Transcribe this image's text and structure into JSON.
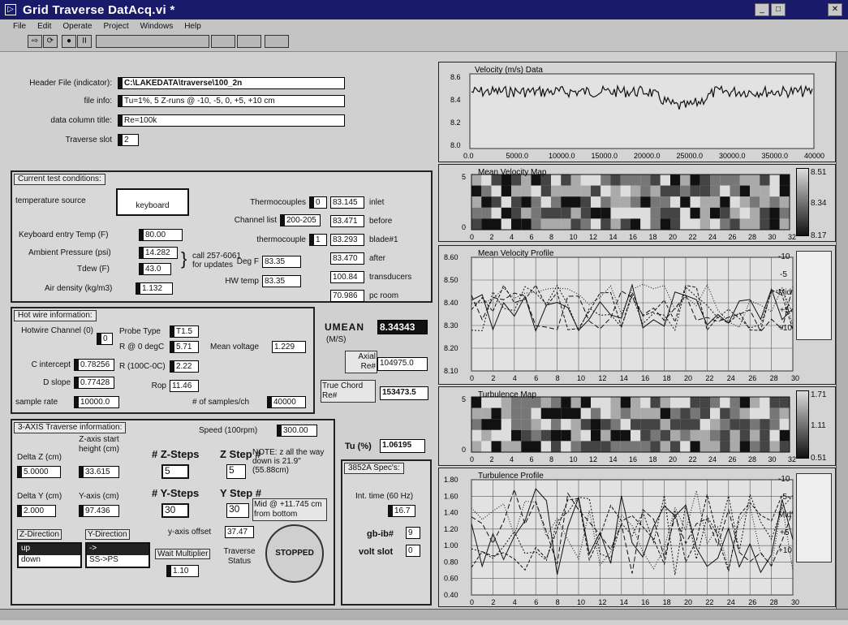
{
  "window": {
    "title": "Grid Traverse DatAcq.vi *"
  },
  "menu": [
    "File",
    "Edit",
    "Operate",
    "Project",
    "Windows",
    "Help"
  ],
  "header": {
    "file_label": "Header File (indicator):",
    "file_value": "C:\\LAKEDATA\\traverse\\100_2n",
    "info_label": "file info:",
    "info_value": "Tu=1%, 5 Z-runs @ -10, -5, 0, +5, +10 cm",
    "col_label": "data column title:",
    "col_value": "Re=100k",
    "slot_label": "Traverse slot",
    "slot_value": "2"
  },
  "conditions": {
    "title": "Current test conditions:",
    "temp_source_label": "temperature source",
    "temp_source_value": "keyboard",
    "keyboard_temp_label": "Keyboard entry Temp (F)",
    "keyboard_temp_value": "80.00",
    "ambient_label": "Ambient Pressure (psi)",
    "ambient_value": "14.282",
    "tdew_label": "Tdew (F)",
    "tdew_value": "43.0",
    "call_note": "call 257-6061 for updates",
    "air_label": "Air density (kg/m3)",
    "air_value": "1.132",
    "thermo_label": "Thermocouples",
    "thermo_value": "0",
    "channel_label": "Channel list",
    "channel_value": "200-205",
    "tc_label": "thermocouple",
    "tc_value": "1",
    "degf_label": "Deg F",
    "degf_value": "83.35",
    "hw_label": "HW temp",
    "hw_value": "83.35",
    "readings": [
      "83.145",
      "83.471",
      "83.293",
      "83.470",
      "100.84",
      "70.986"
    ],
    "locations": [
      "inlet",
      "before",
      "blade#1",
      "after",
      "transducers",
      "pc room"
    ]
  },
  "hotwire": {
    "title": "Hot wire information:",
    "channel_label": "Hotwire Channel (0)",
    "channel_value": "0",
    "probe_label": "Probe Type",
    "probe_value": "T1.5",
    "r0_label": "R @ 0 degC",
    "r0_value": "5.71",
    "mv_label": "Mean voltage",
    "mv_value": "1.229",
    "ci_label": "C intercept",
    "ci_value": "0.78256",
    "ds_label": "D slope",
    "ds_value": "0.77428",
    "r100_label": "R (100C-0C)",
    "r100_value": "2.22",
    "rop_label": "Rop",
    "rop_value": "11.46",
    "sr_label": "sample rate",
    "sr_value": "10000.0",
    "ns_label": "# of samples/ch",
    "ns_value": "40000"
  },
  "umean": {
    "label": "UMEAN",
    "unit": "(M/S)",
    "value": "8.34343"
  },
  "axial": {
    "label": "Axial Re#",
    "value": "104975.0"
  },
  "chord": {
    "label": "True Chord Re#",
    "value": "153473.5"
  },
  "traverse": {
    "title": "3-AXIS Traverse information:",
    "speed_label": "Speed (100rpm)",
    "speed_value": "300.00",
    "dz_label": "Delta Z (cm)",
    "dz_value": "5.0000",
    "zstart_label": "Z-axis start height (cm)",
    "zstart_value": "33.615",
    "zsteps_label": "# Z-Steps",
    "zsteps_value": "5",
    "zstep_label": "Z Step #",
    "zstep_value": "5",
    "note": "NOTE: z all the way down is 21.9\" (55.88cm)",
    "dy_label": "Delta Y (cm)",
    "dy_value": "2.000",
    "yaxis_label": "Y-axis (cm)",
    "yaxis_value": "97.436",
    "ysteps_label": "# Y-Steps",
    "ysteps_value": "30",
    "ystep_label": "Y Step #",
    "ystep_value": "30",
    "mid_note": "Mid @ +11.745 cm from bottom",
    "yoff_label": "y-axis offset",
    "yoff_value": "37.47",
    "zdir_label": "Z-Direction",
    "zdir_options": [
      "up",
      "down"
    ],
    "ydir_label": "Y-Direction",
    "ydir_options": [
      "->",
      "SS->PS"
    ],
    "wait_label": "Wait Multiplier",
    "wait_value": "1.10",
    "status_label": "Traverse Status",
    "status_value": "STOPPED"
  },
  "tu": {
    "label": "Tu (%)",
    "value": "1.06195"
  },
  "spec": {
    "title": "3852A Spec's:",
    "int_label": "Int. time (60 Hz)",
    "int_value": "16.7",
    "gpib_label": "gb-ib#",
    "gpib_value": "9",
    "volt_label": "volt slot",
    "volt_value": "0"
  },
  "plots": {
    "velocity_title": "Velocity (m/s) Data",
    "velocity_y": [
      "8.6",
      "8.4",
      "8.2",
      "8.0"
    ],
    "velocity_x": [
      "0.0",
      "5000.0",
      "10000.0",
      "15000.0",
      "20000.0",
      "25000.0",
      "30000.0",
      "35000.0",
      "40000"
    ],
    "mean_map_title": "Mean Velocity Map",
    "mean_map_y": [
      "5",
      "0"
    ],
    "mean_map_scale": [
      "8.51",
      "8.34",
      "8.17"
    ],
    "mean_profile_title": "Mean Velocity Profile",
    "mean_profile_y": [
      "8.60",
      "8.50",
      "8.40",
      "8.30",
      "8.20",
      "8.10"
    ],
    "turb_map_title": "Turbulence Map",
    "turb_map_y": [
      "5",
      "0"
    ],
    "turb_map_scale": [
      "1.71",
      "1.11",
      "0.51"
    ],
    "turb_profile_title": "Turbulence Profile",
    "turb_profile_y": [
      "1.80",
      "1.60",
      "1.40",
      "1.20",
      "1.00",
      "0.80",
      "0.60",
      "0.40"
    ],
    "grid_x": [
      "0",
      "2",
      "4",
      "6",
      "8",
      "10",
      "12",
      "14",
      "16",
      "18",
      "20",
      "22",
      "24",
      "26",
      "28",
      "30",
      "32"
    ],
    "grid_x30": [
      "0",
      "2",
      "4",
      "6",
      "8",
      "10",
      "12",
      "14",
      "16",
      "18",
      "20",
      "22",
      "24",
      "26",
      "28",
      "30"
    ],
    "legend": [
      "-10",
      "-5",
      "Mid",
      "+5",
      "+10"
    ]
  }
}
